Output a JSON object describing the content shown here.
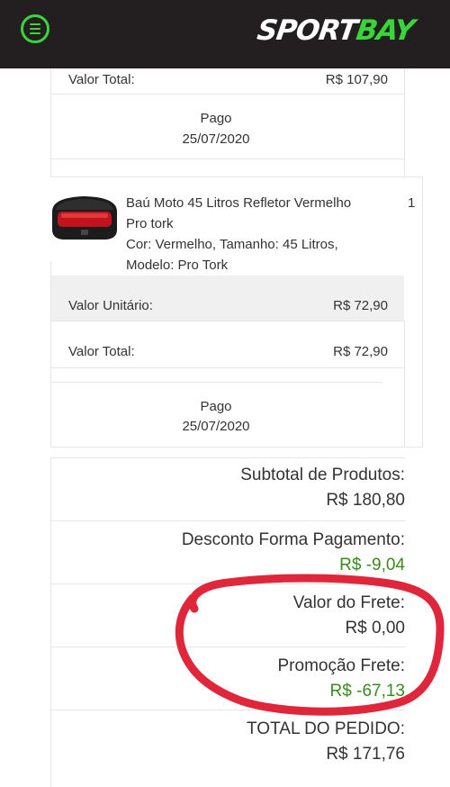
{
  "header": {
    "logo_part1": "SPORT",
    "logo_part2": "BAY",
    "accent_color": "#39d63a",
    "bg_color": "#231f20",
    "menu_icon": "hamburger-menu-icon"
  },
  "order": {
    "item1": {
      "total_label": "Valor Total:",
      "total_value": "R$ 107,90",
      "status": "Pago",
      "date": "25/07/2020"
    },
    "item2": {
      "title_line1": "Baú Moto 45 Litros Refletor Vermelho",
      "title_line2": "Pro tork",
      "attributes_line1": "Cor: Vermelho, Tamanho: 45 Litros,",
      "attributes_line2": "Modelo: Pro Tork",
      "quantity": "1",
      "unit_label": "Valor Unitário:",
      "unit_value": "R$ 72,90",
      "total_label": "Valor Total:",
      "total_value": "R$ 72,90",
      "status": "Pago",
      "date": "25/07/2020",
      "image_icon": "motorcycle-top-case-image"
    }
  },
  "summary": {
    "subtotal_label": "Subtotal de Produtos:",
    "subtotal_value": "R$ 180,80",
    "discount_label": "Desconto Forma Pagamento:",
    "discount_value": "R$ -9,04",
    "shipping_label": "Valor do Frete:",
    "shipping_value": "R$ 0,00",
    "shipping_promo_label": "Promoção Frete:",
    "shipping_promo_value": "R$ -67,13",
    "total_label": "TOTAL DO PEDIDO:",
    "total_value": "R$ 171,76"
  },
  "colors": {
    "discount_green": "#3a8a1f",
    "annotation_red": "#e0263a"
  }
}
